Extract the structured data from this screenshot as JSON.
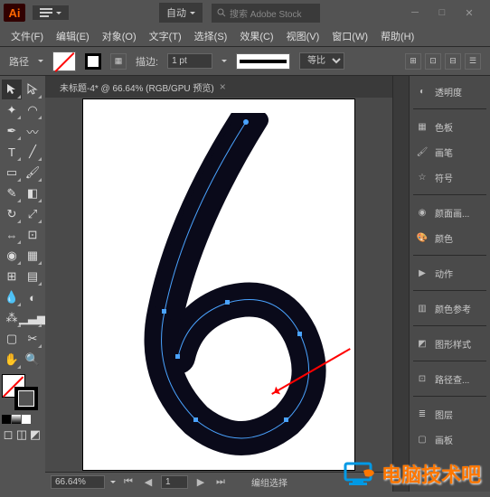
{
  "app": {
    "abbr": "Ai",
    "auto": "自动",
    "search_placeholder": "搜索 Adobe Stock"
  },
  "menu": {
    "file": "文件(F)",
    "edit": "编辑(E)",
    "object": "对象(O)",
    "type": "文字(T)",
    "select": "选择(S)",
    "effect": "效果(C)",
    "view": "视图(V)",
    "window": "窗口(W)",
    "help": "帮助(H)"
  },
  "options": {
    "path_label": "路径",
    "stroke_label": "描边:",
    "stroke_value": "1 pt",
    "scale_label": "等比",
    "profile_label": ""
  },
  "document": {
    "tab_title": "未标题-4* @ 66.64% (RGB/GPU 预览)"
  },
  "status": {
    "zoom": "66.64%",
    "page": "1",
    "mode": "编组选择"
  },
  "panels": {
    "transparency": "透明度",
    "swatches": "色板",
    "brushes": "画笔",
    "symbols": "符号",
    "appearance": "颜面画...",
    "color": "颜色",
    "actions": "动作",
    "colorguide": "颜色参考",
    "gstyles": "图形样式",
    "pathfinder": "路径查...",
    "layers": "图层",
    "artboards": "画板"
  },
  "watermark": {
    "text": "电脑技术吧"
  }
}
